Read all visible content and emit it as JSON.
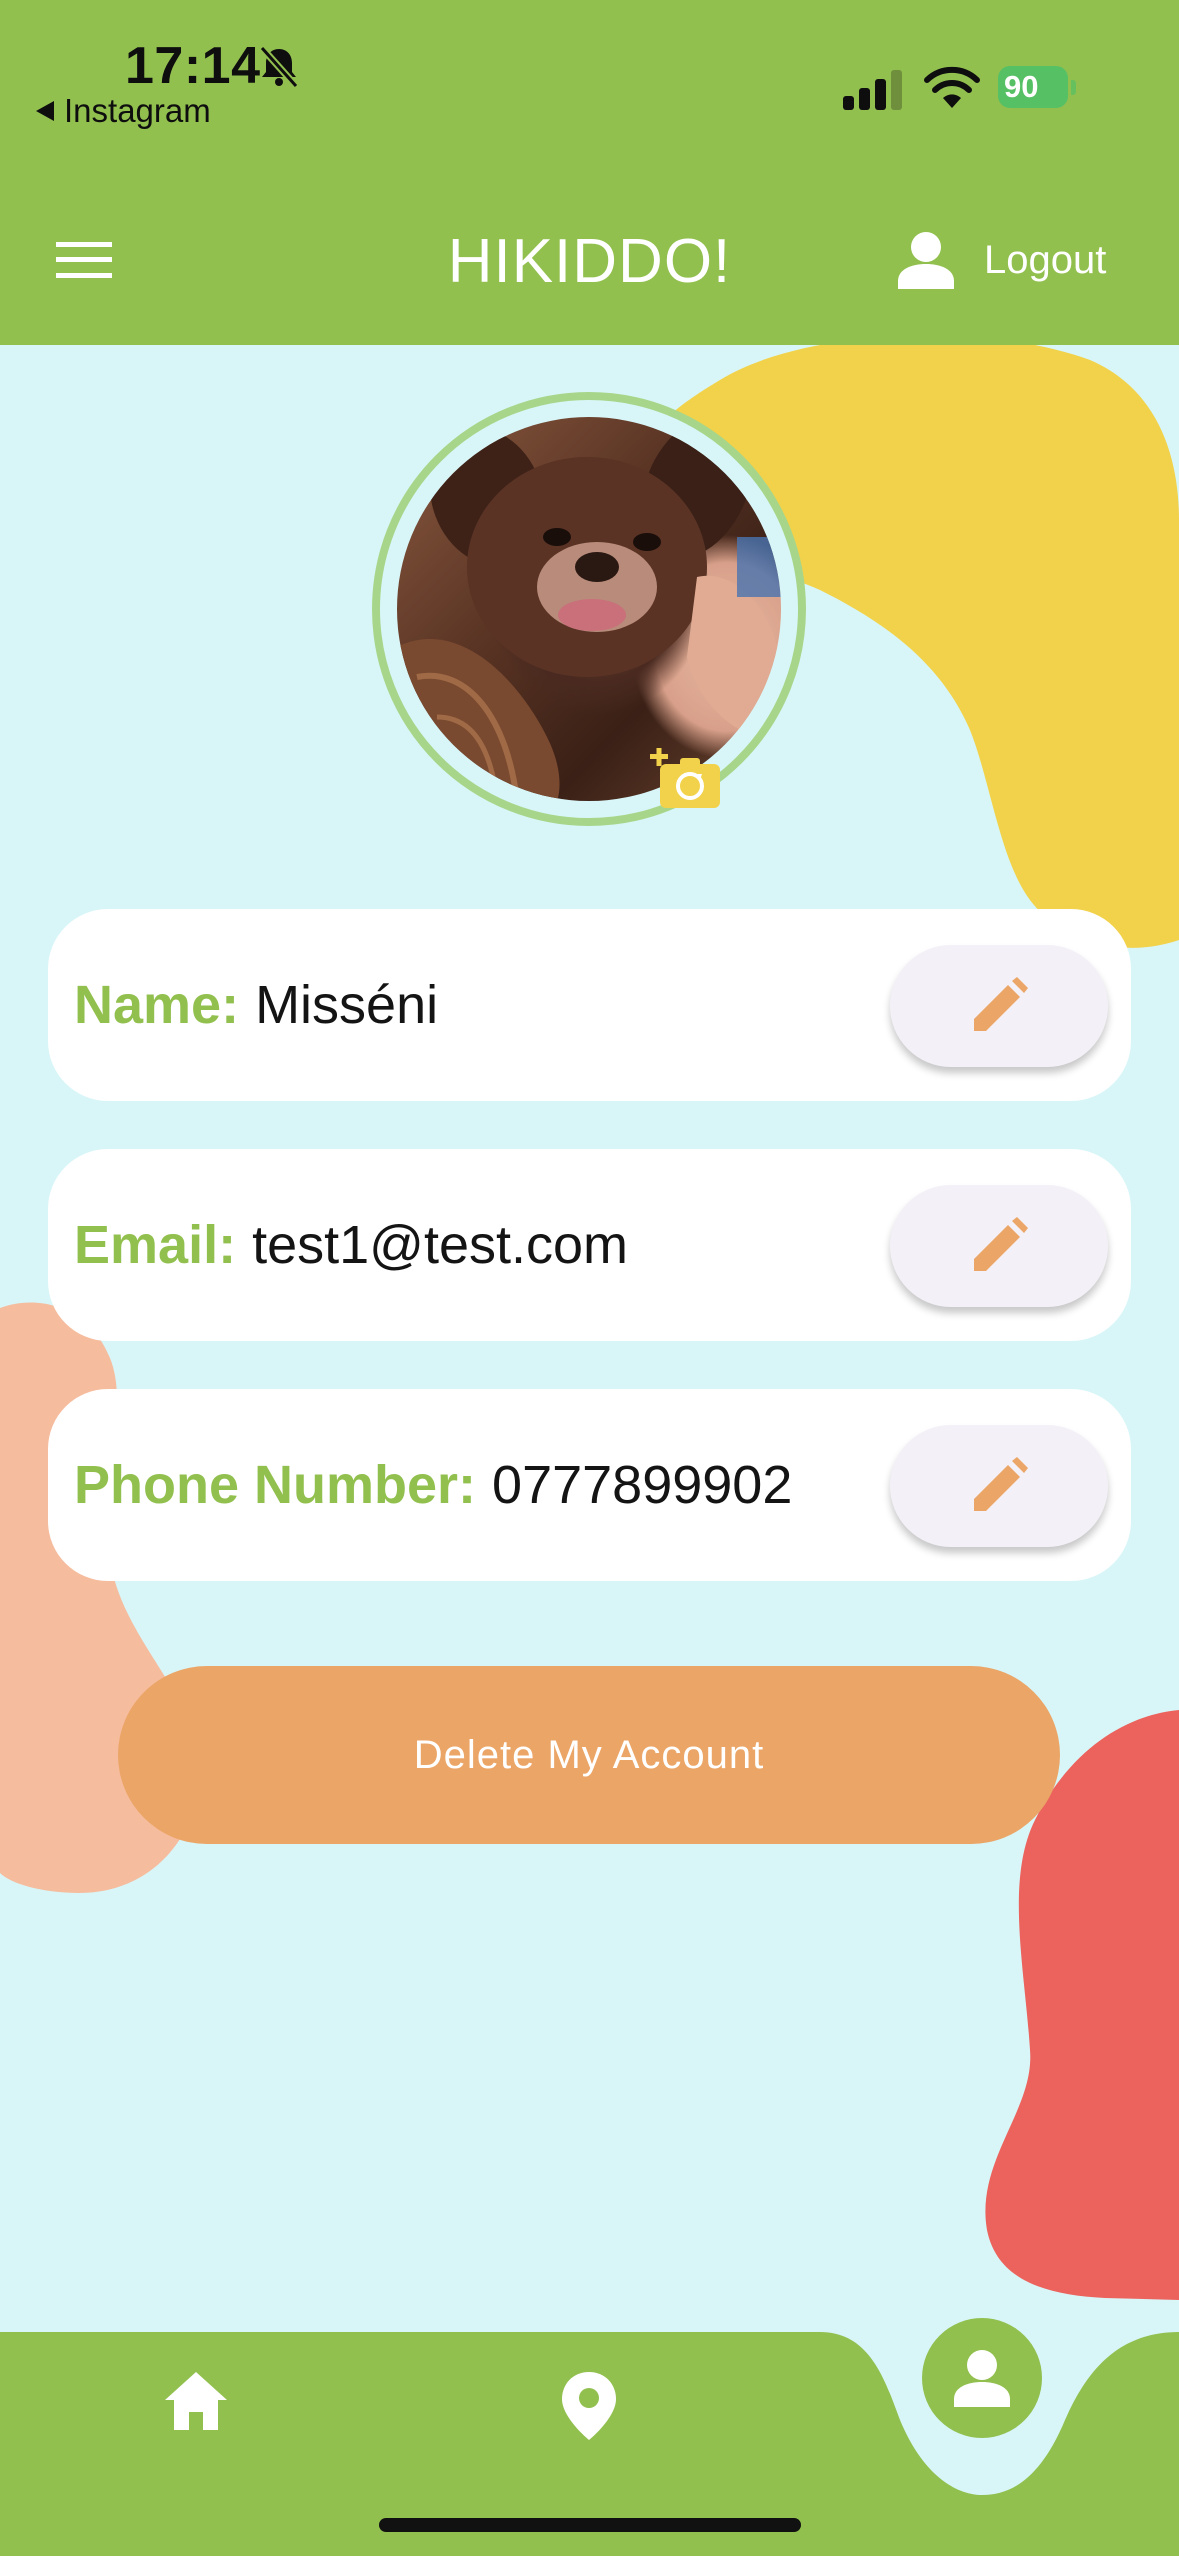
{
  "status_bar": {
    "time": "17:14",
    "back_label": "Instagram",
    "battery_level": "90"
  },
  "app_bar": {
    "title": "HIKIDDO!",
    "logout_label": "Logout"
  },
  "profile": {
    "fields": [
      {
        "label": "Name:",
        "value": "Misséni"
      },
      {
        "label": "Email:",
        "value": "test1@test.com"
      },
      {
        "label": "Phone Number:",
        "value": "0777899902"
      }
    ],
    "delete_label": "Delete My Account"
  },
  "colors": {
    "primary": "#92c04f",
    "accent_orange": "#eba567",
    "background": "#d8f6f8",
    "blob_yellow": "#f2d24a",
    "blob_peach": "#f6bc9e",
    "blob_red": "#ec625c"
  },
  "icons": {
    "menu": "hamburger-icon",
    "user": "user-icon",
    "edit": "pencil-icon",
    "camera": "camera-add-icon",
    "home": "home-icon",
    "map": "location-pin-icon",
    "profile": "profile-icon"
  }
}
